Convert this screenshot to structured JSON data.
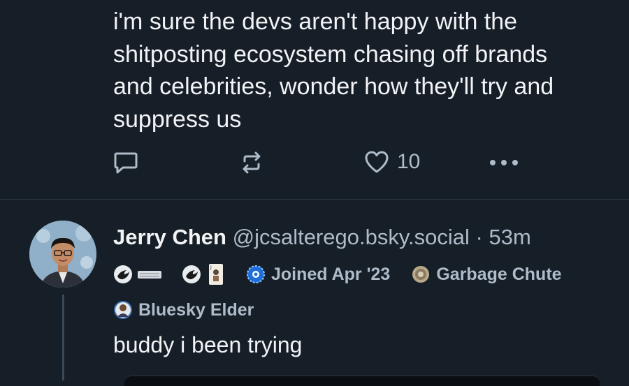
{
  "post": {
    "text": "i'm sure the devs aren't happy with the\nshitposting ecosystem chasing off brands\nand celebrities, wonder how they'll try and\nsuppress us",
    "like_count": "10"
  },
  "reply": {
    "display_name": "Jerry Chen",
    "handle": "@jcsalterego.bsky.social",
    "separator": " · ",
    "timestamp": "53m",
    "badges": {
      "joined": "Joined Apr '23",
      "community": "Garbage Chute",
      "elder": "Bluesky Elder"
    },
    "text": "buddy i been trying"
  },
  "icons": {
    "reply": "reply-bubble-icon",
    "repost": "repost-icon",
    "like": "heart-icon",
    "more": "more-dots-icon"
  },
  "colors": {
    "background": "#161e27",
    "text": "#f1f3f5",
    "muted": "#aebbc9",
    "divider": "#2e3a46"
  }
}
